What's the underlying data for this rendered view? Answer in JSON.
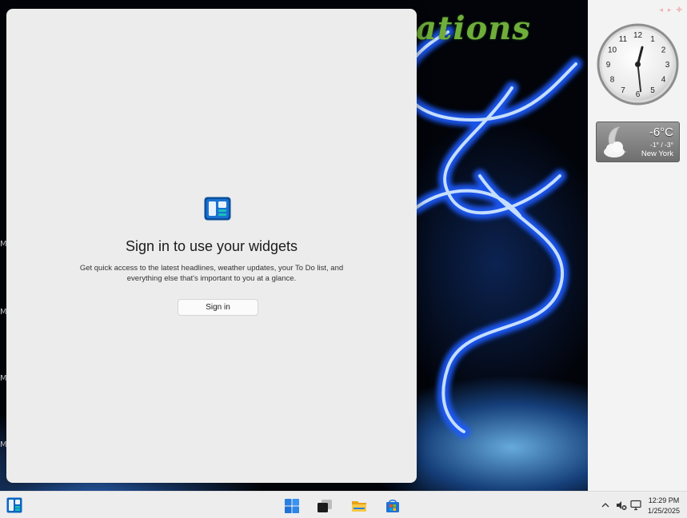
{
  "wallpaper": {
    "title_fragment": "ations",
    "edge_letters": [
      "M",
      "M",
      "M",
      "M"
    ]
  },
  "widgets_panel": {
    "title": "Sign in to use your widgets",
    "description": "Get quick access to the latest headlines, weather updates, your To Do list, and everything else that's important to you at a glance.",
    "signin_label": "Sign in"
  },
  "sidebar": {
    "controls": [
      "◂",
      "▸",
      "✚"
    ],
    "clock": {
      "numbers": [
        "12",
        "1",
        "2",
        "3",
        "4",
        "5",
        "6",
        "7",
        "8",
        "9",
        "10",
        "11"
      ],
      "hour": 12,
      "minute": 29
    },
    "weather": {
      "temp": "-6°C",
      "range": "-1° / -3°",
      "city": "New York"
    }
  },
  "taskbar": {
    "time": "12:29 PM",
    "date": "1/25/2025",
    "tray_chevron": "^"
  },
  "colors": {
    "accent_blue": "#0067c0",
    "panel_bg": "#ececec",
    "taskbar_bg": "#ededed",
    "wallpaper_text_green": "#6fae3a"
  }
}
